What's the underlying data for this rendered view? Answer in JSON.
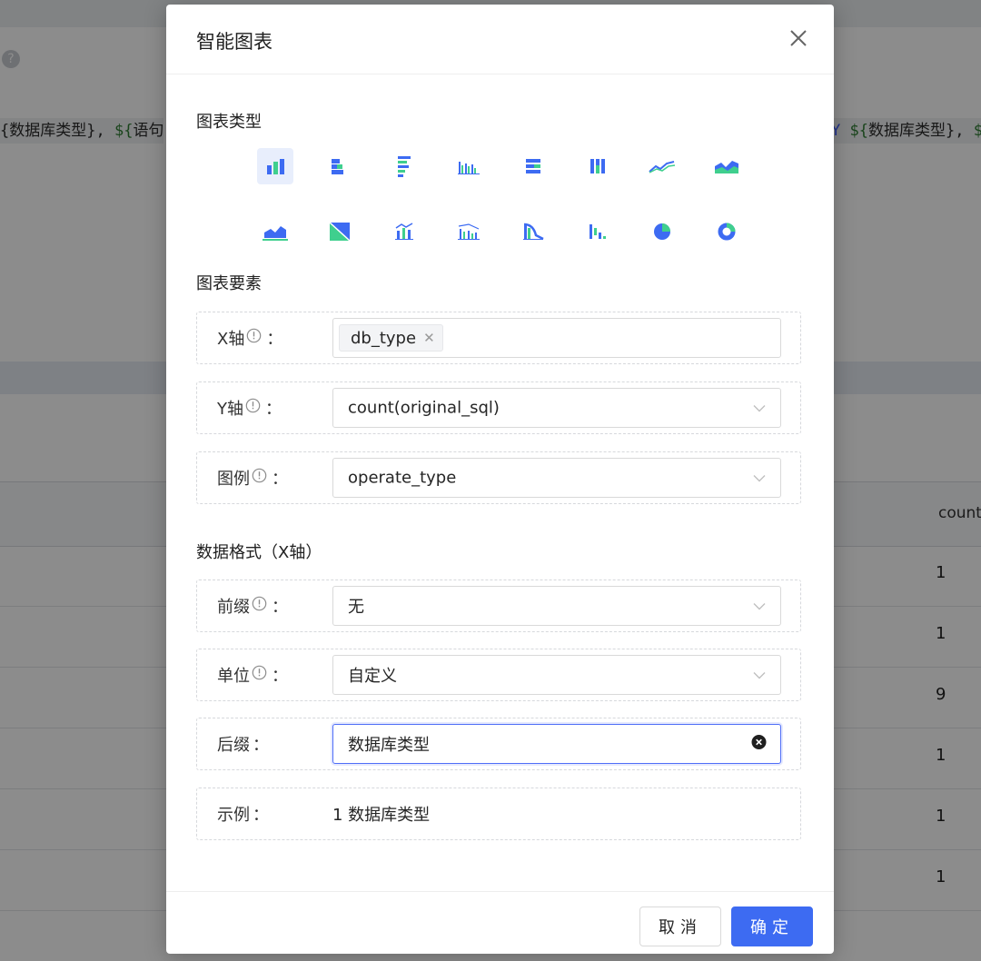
{
  "background": {
    "sql_left": [
      "{数据库类型}, ",
      "${",
      "语句"
    ],
    "sql_right": [
      "Y ",
      "${",
      "数据库类型}, ",
      "$"
    ],
    "table_column_header": "count",
    "table_values": [
      "1",
      "1",
      "9",
      "1",
      "1",
      "1"
    ]
  },
  "modal": {
    "title": "智能图表",
    "sections": {
      "chart_type": "图表类型",
      "chart_elements": "图表要素",
      "data_format": "数据格式（X轴）"
    },
    "chart_types": [
      {
        "icon": "column-chart-icon"
      },
      {
        "icon": "stacked-bar-chart-icon"
      },
      {
        "icon": "horizontal-bar-chart-icon"
      },
      {
        "icon": "grouped-column-chart-icon"
      },
      {
        "icon": "stacked-horizontal-bar-icon"
      },
      {
        "icon": "stacked-column-chart-icon"
      },
      {
        "icon": "line-chart-icon"
      },
      {
        "icon": "area-line-chart-icon"
      },
      {
        "icon": "area-chart-icon"
      },
      {
        "icon": "scatter-area-chart-icon"
      },
      {
        "icon": "dual-axis-chart-icon"
      },
      {
        "icon": "column-line-chart-icon"
      },
      {
        "icon": "funnel-line-chart-icon"
      },
      {
        "icon": "waterfall-chart-icon"
      },
      {
        "icon": "pie-chart-icon"
      },
      {
        "icon": "donut-chart-icon"
      }
    ],
    "fields": {
      "x_axis": {
        "label": "X轴",
        "tag": "db_type"
      },
      "y_axis": {
        "label": "Y轴",
        "value": "count(original_sql)"
      },
      "legend": {
        "label": "图例",
        "value": "operate_type"
      },
      "prefix": {
        "label": "前缀",
        "value": "无"
      },
      "unit": {
        "label": "单位",
        "value": "自定义"
      },
      "suffix": {
        "label": "后缀",
        "value": "数据库类型"
      },
      "example": {
        "label": "示例",
        "value": "1 数据库类型"
      }
    },
    "colon": "：",
    "buttons": {
      "cancel": "取消",
      "ok": "确定"
    },
    "colors": {
      "primary": "#3d6bf2",
      "chart_blue": "#3d6bf2",
      "chart_green": "#3fcf8e"
    }
  }
}
